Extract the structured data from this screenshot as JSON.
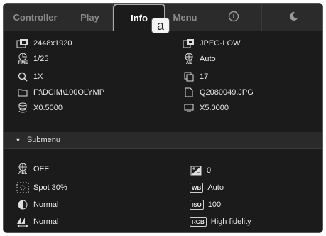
{
  "tabs": [
    {
      "label": "Controller"
    },
    {
      "label": "Play"
    },
    {
      "label": "Info"
    },
    {
      "label": "Menu"
    }
  ],
  "callout": "a",
  "info": {
    "image_size": "2448x1920",
    "quality": "JPEG-LOW",
    "shutter": "1/25",
    "ae": "Auto",
    "zoom": "1X",
    "count": "17",
    "folder": "F:\\DCIM\\100OLYMP",
    "filename": "Q2080049.JPG",
    "left_ratio": "X0.5000",
    "right_ratio": "X5.0000"
  },
  "submenu": {
    "label": "Submenu",
    "ael": "OFF",
    "exposure_comp": "0",
    "metering": "Spot 30%",
    "wb": "Auto",
    "contrast": "Normal",
    "iso": "100",
    "sharpness": "Normal",
    "color": "High fidelity"
  },
  "badges": {
    "wb": "WB",
    "iso": "ISO",
    "rgb": "RGB"
  },
  "icon_labels": {
    "time": "TIME",
    "ae": "AE",
    "ael": "AEL"
  }
}
